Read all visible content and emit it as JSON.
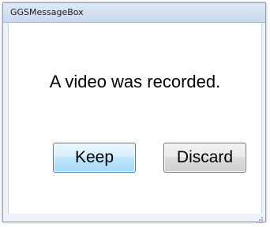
{
  "window": {
    "title": "GGSMessageBox"
  },
  "dialog": {
    "message": "A video was recorded.",
    "buttons": {
      "keep_label": "Keep",
      "discard_label": "Discard"
    }
  },
  "icons": {
    "resize_grip": "resize-grip-icon"
  },
  "colors": {
    "default_button_border": "#3c7fb1",
    "window_frame": "#eef3f9"
  }
}
